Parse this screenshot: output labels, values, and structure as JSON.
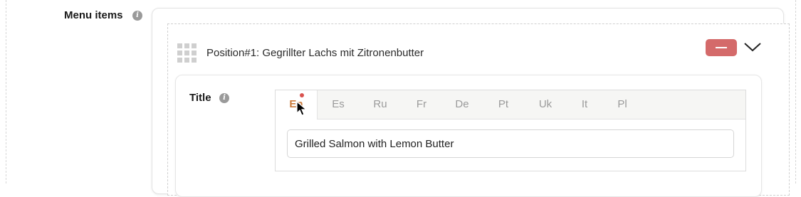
{
  "form": {
    "menu_items_label": "Menu items",
    "info_icon_glyph": "i"
  },
  "item": {
    "title": "Position#1: Gegrillter Lachs mit Zitronenbutter",
    "remove_glyph": "—",
    "remove_color": "#d46a6a",
    "handle_icon": "grid-drag-handle-icon",
    "collapse_icon": "chevron-down-icon"
  },
  "title_field": {
    "label": "Title",
    "active_tab_color": "#c9793a",
    "tabs": [
      {
        "label": "En",
        "active": true,
        "has_error_dot": true
      },
      {
        "label": "Es"
      },
      {
        "label": "Ru"
      },
      {
        "label": "Fr"
      },
      {
        "label": "De"
      },
      {
        "label": "Pt"
      },
      {
        "label": "Uk"
      },
      {
        "label": "It"
      },
      {
        "label": "Pl"
      }
    ],
    "value": "Grilled Salmon with Lemon Butter",
    "error_dot_color": "#d9534f"
  }
}
